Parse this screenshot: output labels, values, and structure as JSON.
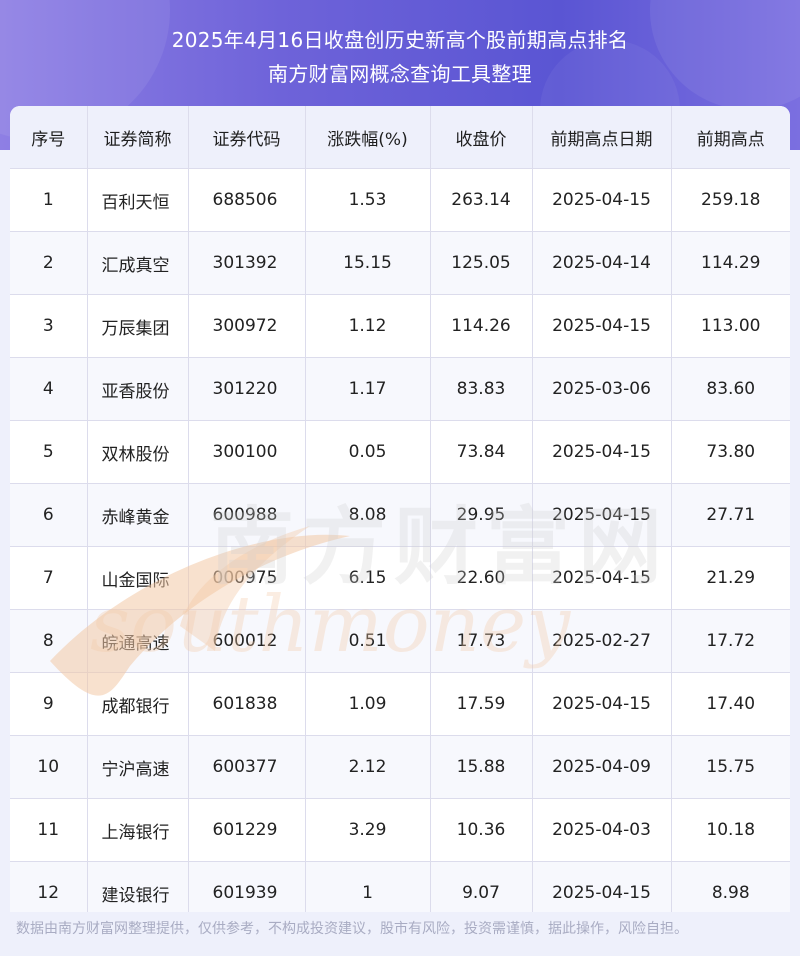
{
  "header": {
    "title_line1": "2025年4月16日收盘创历史新高个股前期高点排名",
    "title_line2": "南方财富网概念查询工具整理"
  },
  "table": {
    "columns": [
      "序号",
      "证券简称",
      "证券代码",
      "涨跌幅(%)",
      "收盘价",
      "前期高点日期",
      "前期高点"
    ],
    "rows": [
      [
        "1",
        "百利天恒",
        "688506",
        "1.53",
        "263.14",
        "2025-04-15",
        "259.18"
      ],
      [
        "2",
        "汇成真空",
        "301392",
        "15.15",
        "125.05",
        "2025-04-14",
        "114.29"
      ],
      [
        "3",
        "万辰集团",
        "300972",
        "1.12",
        "114.26",
        "2025-04-15",
        "113.00"
      ],
      [
        "4",
        "亚香股份",
        "301220",
        "1.17",
        "83.83",
        "2025-03-06",
        "83.60"
      ],
      [
        "5",
        "双林股份",
        "300100",
        "0.05",
        "73.84",
        "2025-04-15",
        "73.80"
      ],
      [
        "6",
        "赤峰黄金",
        "600988",
        "8.08",
        "29.95",
        "2025-04-15",
        "27.71"
      ],
      [
        "7",
        "山金国际",
        "000975",
        "6.15",
        "22.60",
        "2025-04-15",
        "21.29"
      ],
      [
        "8",
        "皖通高速",
        "600012",
        "0.51",
        "17.73",
        "2025-02-27",
        "17.72"
      ],
      [
        "9",
        "成都银行",
        "601838",
        "1.09",
        "17.59",
        "2025-04-15",
        "17.40"
      ],
      [
        "10",
        "宁沪高速",
        "600377",
        "2.12",
        "15.88",
        "2025-04-09",
        "15.75"
      ],
      [
        "11",
        "上海银行",
        "601229",
        "3.29",
        "10.36",
        "2025-04-03",
        "10.18"
      ],
      [
        "12",
        "建设银行",
        "601939",
        "1",
        "9.07",
        "2025-04-15",
        "8.98"
      ]
    ]
  },
  "watermark": {
    "cn": "南方财富网",
    "en": "southmoney"
  },
  "footer": {
    "disclaimer": "数据由南方财富网整理提供，仅供参考，不构成投资建议，股市有风险，投资需谨慎，据此操作，风险自担。"
  },
  "colors": {
    "header_accent": "#6e63d9",
    "table_header_bg": "#eef0fb",
    "grid_line": "#dcdcec",
    "watermark": "#f3c9a6"
  }
}
